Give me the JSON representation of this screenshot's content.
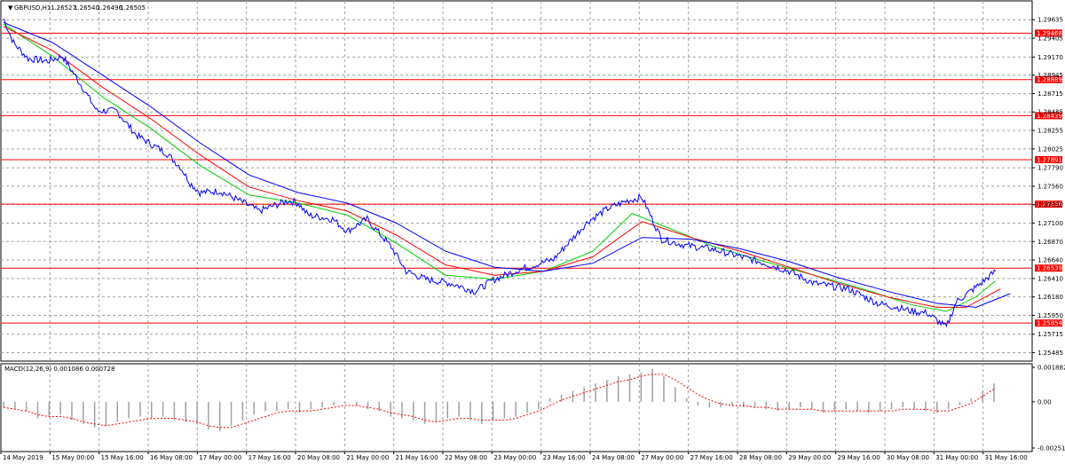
{
  "chart_data": {
    "type": "line",
    "symbol": "GBPUSD,H1",
    "ohlc": {
      "open": "1.26527",
      "high": "1.26540",
      "low": "1.26496",
      "close": "1.26505"
    },
    "ylim": [
      1.2538,
      1.2987
    ],
    "y_ticks": [
      "1.29635",
      "1.29405",
      "1.29170",
      "1.28945",
      "1.28715",
      "1.28485",
      "1.28255",
      "1.28025",
      "1.27790",
      "1.27560",
      "1.27330",
      "1.27100",
      "1.26870",
      "1.26640",
      "1.26410",
      "1.26180",
      "1.25950",
      "1.25715",
      "1.25485"
    ],
    "horizontal_levels": [
      {
        "label": "1.29468",
        "value": 1.29468
      },
      {
        "label": "1.28889",
        "value": 1.28889
      },
      {
        "label": "1.28439",
        "value": 1.28439
      },
      {
        "label": "1.27891",
        "value": 1.27891
      },
      {
        "label": "1.27336",
        "value": 1.27336
      },
      {
        "label": "1.26539",
        "value": 1.26539
      },
      {
        "label": "1.25854",
        "value": 1.25854
      }
    ],
    "x_labels": [
      "14 May 2019",
      "15 May 00:00",
      "15 May 16:00",
      "16 May 08:00",
      "17 May 00:00",
      "17 May 16:00",
      "20 May 08:00",
      "21 May 00:00",
      "21 May 16:00",
      "22 May 08:00",
      "23 May 00:00",
      "23 May 16:00",
      "24 May 08:00",
      "27 May 00:00",
      "27 May 16:00",
      "28 May 08:00",
      "29 May 00:00",
      "29 May 16:00",
      "30 May 08:00",
      "31 May 00:00",
      "31 May 16:00"
    ],
    "price_series": [
      {
        "x": 0,
        "v": 1.2965
      },
      {
        "x": 0.2,
        "v": 1.2935
      },
      {
        "x": 0.5,
        "v": 1.2915
      },
      {
        "x": 0.9,
        "v": 1.2912
      },
      {
        "x": 1.2,
        "v": 1.2918
      },
      {
        "x": 1.6,
        "v": 1.288
      },
      {
        "x": 1.9,
        "v": 1.285
      },
      {
        "x": 2.3,
        "v": 1.285
      },
      {
        "x": 2.7,
        "v": 1.282
      },
      {
        "x": 3.1,
        "v": 1.2805
      },
      {
        "x": 3.3,
        "v": 1.2798
      },
      {
        "x": 3.6,
        "v": 1.278
      },
      {
        "x": 3.8,
        "v": 1.276
      },
      {
        "x": 4.0,
        "v": 1.2748
      },
      {
        "x": 4.4,
        "v": 1.275
      },
      {
        "x": 4.9,
        "v": 1.2735
      },
      {
        "x": 5.2,
        "v": 1.2725
      },
      {
        "x": 5.8,
        "v": 1.2738
      },
      {
        "x": 6.0,
        "v": 1.2735
      },
      {
        "x": 6.2,
        "v": 1.272
      },
      {
        "x": 6.7,
        "v": 1.2715
      },
      {
        "x": 7.0,
        "v": 1.27
      },
      {
        "x": 7.4,
        "v": 1.2715
      },
      {
        "x": 7.9,
        "v": 1.268
      },
      {
        "x": 8.2,
        "v": 1.265
      },
      {
        "x": 8.6,
        "v": 1.264
      },
      {
        "x": 9.1,
        "v": 1.2635
      },
      {
        "x": 9.6,
        "v": 1.2625
      },
      {
        "x": 10.0,
        "v": 1.264
      },
      {
        "x": 10.5,
        "v": 1.2652
      },
      {
        "x": 11.2,
        "v": 1.2665
      },
      {
        "x": 11.9,
        "v": 1.2712
      },
      {
        "x": 12.3,
        "v": 1.2728
      },
      {
        "x": 12.7,
        "v": 1.2738
      },
      {
        "x": 13.0,
        "v": 1.2742
      },
      {
        "x": 13.4,
        "v": 1.269
      },
      {
        "x": 13.9,
        "v": 1.2682
      },
      {
        "x": 14.4,
        "v": 1.2678
      },
      {
        "x": 14.9,
        "v": 1.267
      },
      {
        "x": 15.5,
        "v": 1.266
      },
      {
        "x": 16.0,
        "v": 1.265
      },
      {
        "x": 16.5,
        "v": 1.2635
      },
      {
        "x": 17.2,
        "v": 1.2628
      },
      {
        "x": 17.8,
        "v": 1.261
      },
      {
        "x": 18.2,
        "v": 1.2605
      },
      {
        "x": 18.5,
        "v": 1.26
      },
      {
        "x": 18.8,
        "v": 1.2598
      },
      {
        "x": 19.2,
        "v": 1.258
      },
      {
        "x": 19.4,
        "v": 1.2612
      },
      {
        "x": 19.8,
        "v": 1.263
      },
      {
        "x": 20.2,
        "v": 1.265
      }
    ],
    "ma_series": [
      {
        "name": "",
        "color": "#00cc00",
        "values": [
          [
            0,
            1.2958
          ],
          [
            1,
            1.2918
          ],
          [
            2,
            1.2868
          ],
          [
            3,
            1.2828
          ],
          [
            4,
            1.2782
          ],
          [
            5,
            1.2745
          ],
          [
            6,
            1.2735
          ],
          [
            7,
            1.272
          ],
          [
            8,
            1.2685
          ],
          [
            9,
            1.2645
          ],
          [
            10,
            1.264
          ],
          [
            11,
            1.265
          ],
          [
            12,
            1.2675
          ],
          [
            12.8,
            1.2722
          ],
          [
            13.5,
            1.2705
          ],
          [
            14.5,
            1.268
          ],
          [
            15.5,
            1.2662
          ],
          [
            16.5,
            1.2645
          ],
          [
            17.5,
            1.2628
          ],
          [
            18.5,
            1.2608
          ],
          [
            19.2,
            1.26
          ],
          [
            19.8,
            1.2618
          ],
          [
            20.2,
            1.2638
          ]
        ]
      },
      {
        "name": "",
        "color": "#ff0000",
        "values": [
          [
            0,
            1.2955
          ],
          [
            1,
            1.2925
          ],
          [
            2,
            1.288
          ],
          [
            3,
            1.284
          ],
          [
            4,
            1.2795
          ],
          [
            5,
            1.2755
          ],
          [
            6,
            1.2738
          ],
          [
            7,
            1.2725
          ],
          [
            8,
            1.2695
          ],
          [
            9,
            1.2658
          ],
          [
            10,
            1.2645
          ],
          [
            11,
            1.265
          ],
          [
            12,
            1.2668
          ],
          [
            13,
            1.2712
          ],
          [
            14,
            1.2692
          ],
          [
            15,
            1.2675
          ],
          [
            16,
            1.2655
          ],
          [
            17,
            1.2635
          ],
          [
            18,
            1.2618
          ],
          [
            19,
            1.2605
          ],
          [
            19.6,
            1.2605
          ],
          [
            20.3,
            1.2628
          ]
        ]
      },
      {
        "name": "",
        "color": "#0000ff",
        "values": [
          [
            0,
            1.296
          ],
          [
            1,
            1.2935
          ],
          [
            2,
            1.2895
          ],
          [
            3,
            1.2855
          ],
          [
            4,
            1.281
          ],
          [
            5,
            1.277
          ],
          [
            6,
            1.2748
          ],
          [
            7,
            1.2735
          ],
          [
            8,
            1.271
          ],
          [
            9,
            1.2675
          ],
          [
            10,
            1.2655
          ],
          [
            11,
            1.265
          ],
          [
            12,
            1.266
          ],
          [
            13,
            1.2692
          ],
          [
            14,
            1.269
          ],
          [
            15,
            1.2678
          ],
          [
            16,
            1.2662
          ],
          [
            17,
            1.2642
          ],
          [
            18,
            1.2625
          ],
          [
            19,
            1.261
          ],
          [
            19.8,
            1.2605
          ],
          [
            20.5,
            1.2622
          ]
        ]
      }
    ],
    "macd": {
      "label": "MACD(12,26,9) 0.001086 0.000728",
      "y_ticks": [
        "0.001882",
        "0.00",
        "-0.002516"
      ],
      "ylim": [
        -0.002516,
        0.001882
      ],
      "histogram": [
        -0.0003,
        -0.0004,
        -0.0005,
        -0.0009,
        -0.0008,
        -0.0007,
        -0.001,
        -0.0012,
        -0.0014,
        -0.0013,
        -0.0011,
        -0.0009,
        -0.0008,
        -0.0009,
        -0.0008,
        -0.001,
        -0.0011,
        -0.0012,
        -0.0015,
        -0.0016,
        -0.0013,
        -0.001,
        -0.0007,
        -0.0005,
        -0.0005,
        -0.0004,
        -0.0006,
        -0.0004,
        -0.0003,
        -0.0002,
        -0.0001,
        -0.0002,
        -0.0004,
        -0.0005,
        -0.0008,
        -0.0009,
        -0.001,
        -0.0012,
        -0.0011,
        -0.0009,
        -0.0008,
        -0.001,
        -0.0012,
        -0.001,
        -0.0009,
        -0.0008,
        -0.0006,
        -0.0004,
        0.0002,
        0.0004,
        0.0006,
        0.0008,
        0.001,
        0.0012,
        0.0014,
        0.0015,
        0.0016,
        0.0018,
        0.0014,
        0.0008,
        0.0002,
        -0.0002,
        -0.0003,
        -0.0003,
        -0.0002,
        -0.0003,
        -0.0003,
        -0.0004,
        -0.0005,
        -0.0004,
        -0.0003,
        -0.0004,
        -0.0006,
        -0.0005,
        -0.0004,
        -0.0005,
        -0.0006,
        -0.0005,
        -0.0004,
        -0.0003,
        -0.0004,
        -0.0005,
        -0.0006,
        -0.0004,
        -0.0002,
        0.0002,
        0.0006,
        0.001
      ],
      "signal": [
        -0.0003,
        -0.0004,
        -0.0005,
        -0.0007,
        -0.0008,
        -0.0008,
        -0.0009,
        -0.0011,
        -0.0012,
        -0.0013,
        -0.0012,
        -0.0011,
        -0.001,
        -0.0009,
        -0.0009,
        -0.0009,
        -0.001,
        -0.0011,
        -0.0013,
        -0.0014,
        -0.0014,
        -0.0012,
        -0.001,
        -0.0008,
        -0.0006,
        -0.0005,
        -0.0005,
        -0.0005,
        -0.0004,
        -0.0003,
        -0.0002,
        -0.0002,
        -0.0003,
        -0.0004,
        -0.0006,
        -0.0007,
        -0.0008,
        -0.001,
        -0.0011,
        -0.001,
        -0.0009,
        -0.0009,
        -0.001,
        -0.001,
        -0.001,
        -0.0009,
        -0.0007,
        -0.0005,
        -0.0002,
        0.0001,
        0.0003,
        0.0005,
        0.0007,
        0.0009,
        0.0011,
        0.0012,
        0.0014,
        0.0015,
        0.0015,
        0.0012,
        0.0008,
        0.0004,
        0.0001,
        -0.0001,
        -0.0002,
        -0.0002,
        -0.0003,
        -0.0003,
        -0.0004,
        -0.0004,
        -0.0004,
        -0.0004,
        -0.0005,
        -0.0005,
        -0.0005,
        -0.0005,
        -0.0005,
        -0.0005,
        -0.0005,
        -0.0004,
        -0.0004,
        -0.0004,
        -0.0005,
        -0.0005,
        -0.0003,
        -0.0001,
        0.0003,
        0.0007
      ]
    },
    "grid": true,
    "colors": {
      "price": "#0000ff",
      "level": "#ff0000",
      "level_label_bg": "#ff0000",
      "grid": "#a0a0a0",
      "macd_hist": "#a0a0a0",
      "macd_signal": "#ff0000"
    }
  }
}
